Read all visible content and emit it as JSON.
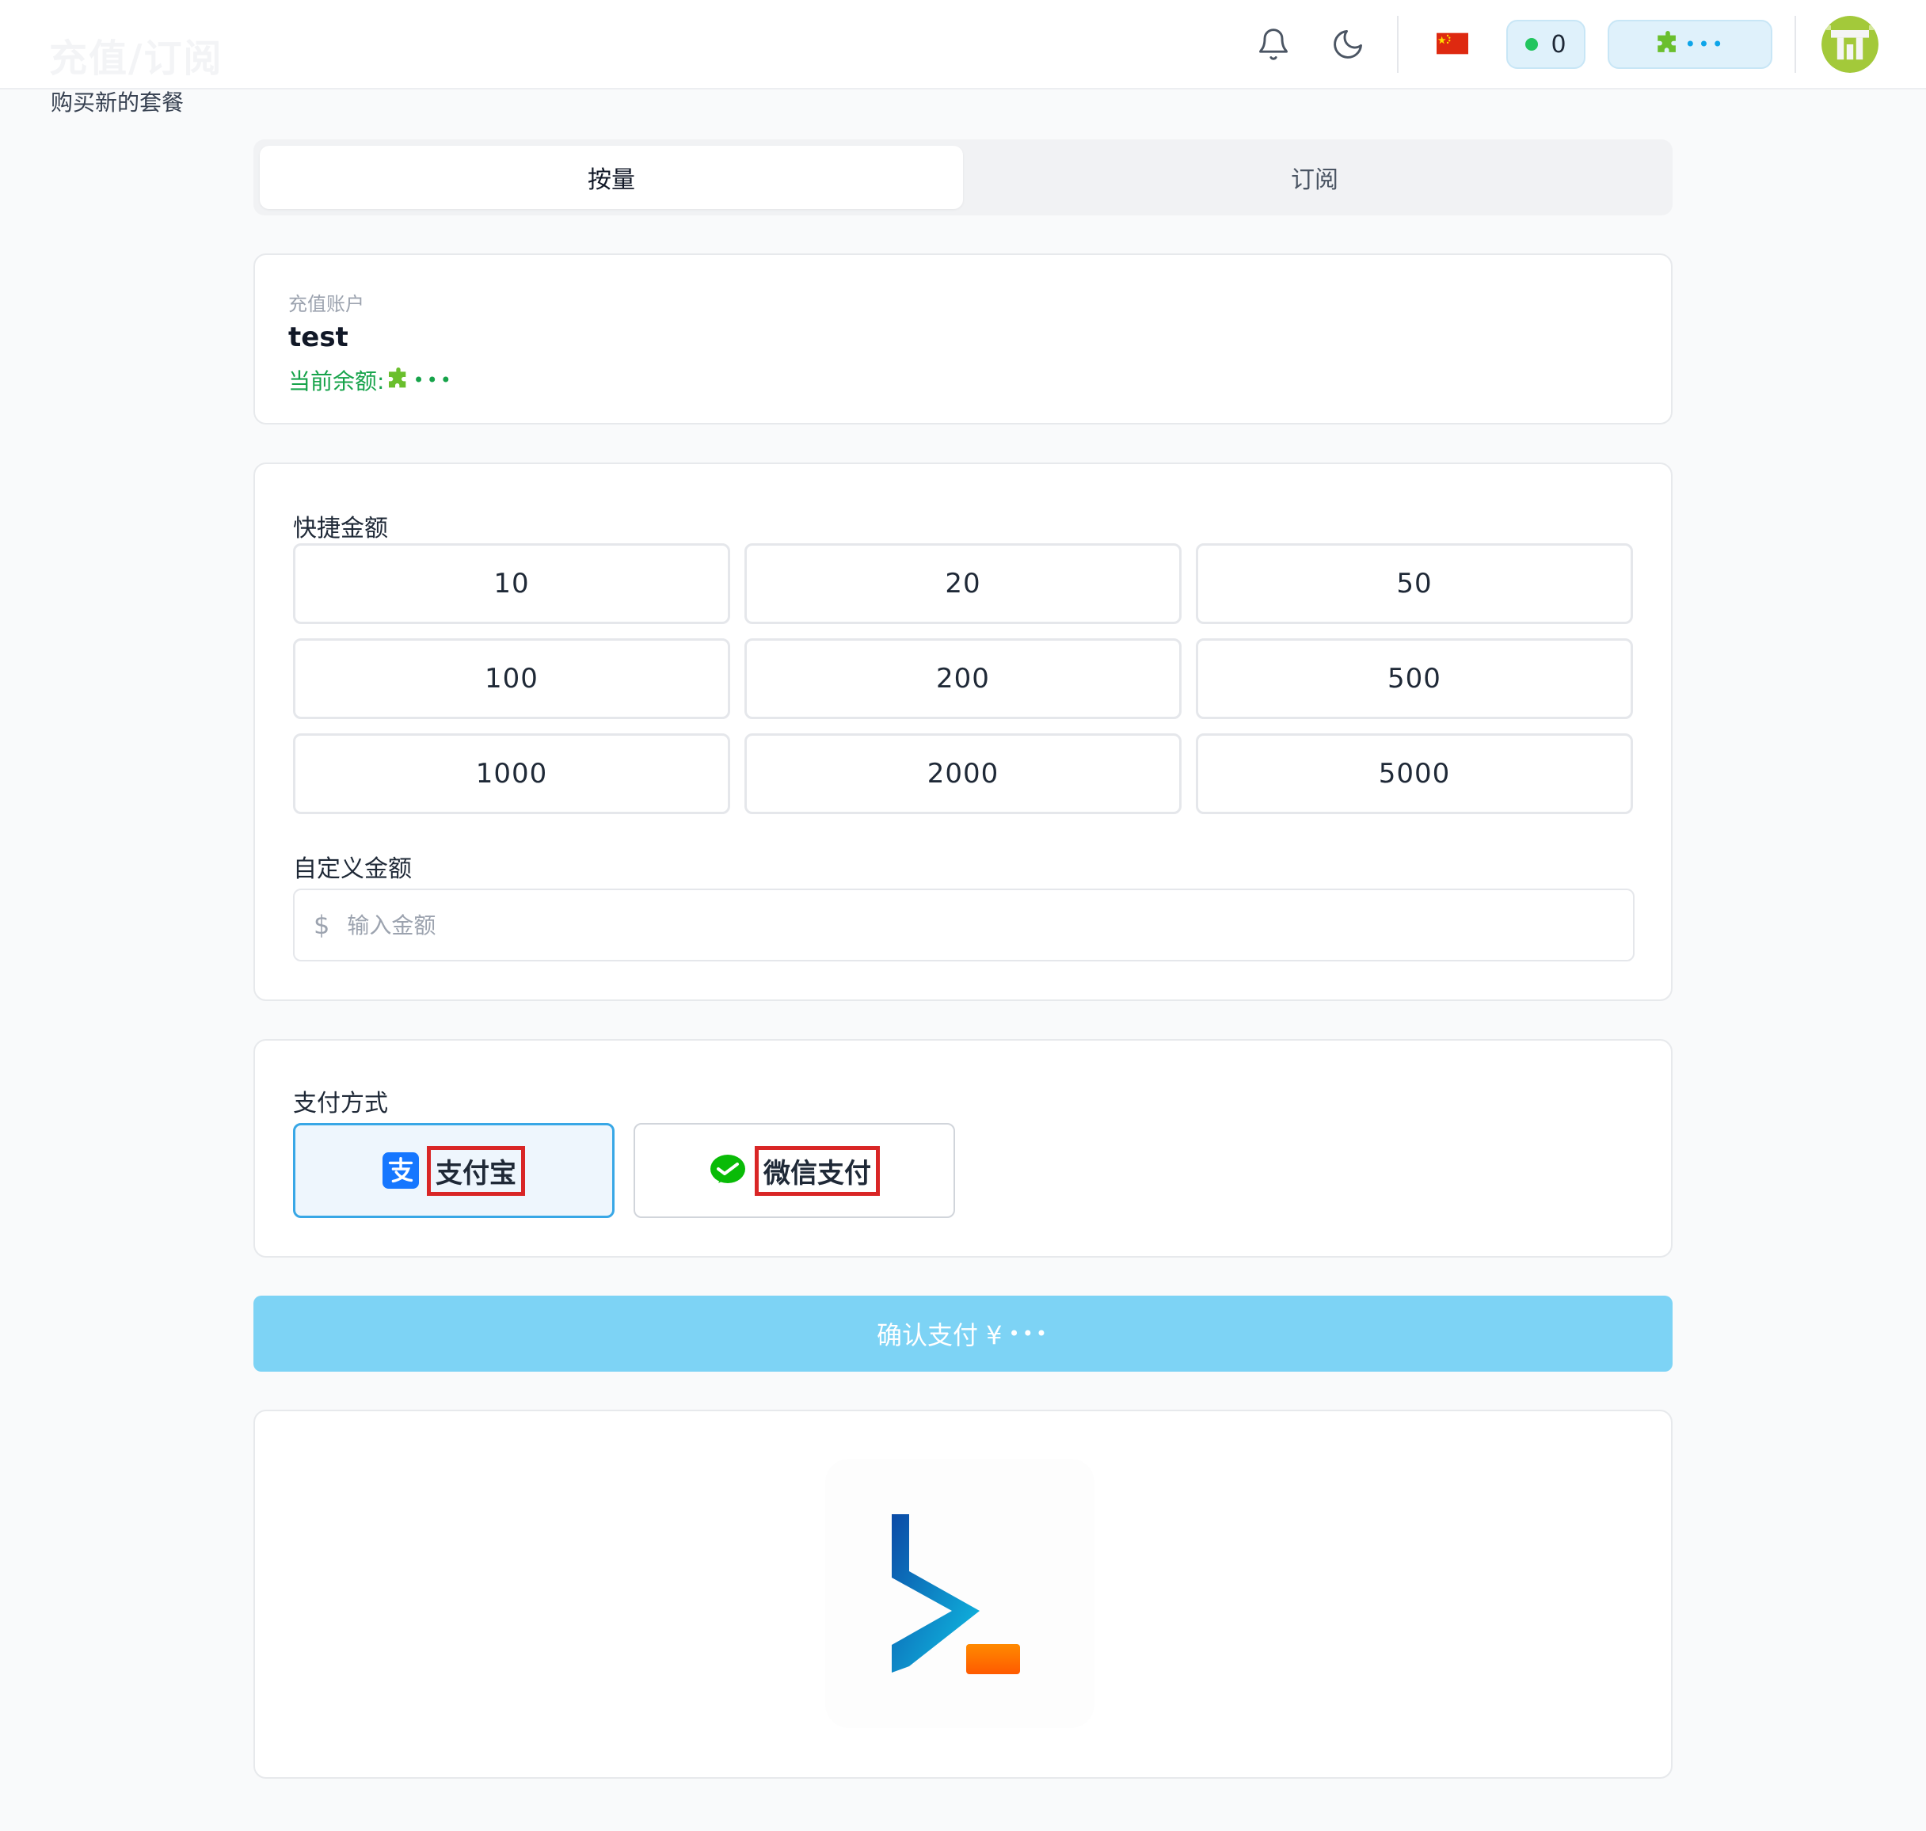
{
  "header": {
    "title": "充值/订阅",
    "subtitle": "购买新的套餐",
    "flag_icon": "china-flag-icon",
    "status_count": "0",
    "balance_mask": "•••",
    "status_color": "#22c55e"
  },
  "tabs": [
    {
      "label": "按量",
      "active": true
    },
    {
      "label": "订阅",
      "active": false
    }
  ],
  "account": {
    "label": "充值账户",
    "name": "test",
    "balance_label": "当前余额:",
    "balance_mask": "•••"
  },
  "amounts": {
    "label": "快捷金额",
    "options": [
      "10",
      "20",
      "50",
      "100",
      "200",
      "500",
      "1000",
      "2000",
      "5000"
    ],
    "custom_label": "自定义金额",
    "currency_symbol": "$",
    "custom_placeholder": "输入金额"
  },
  "payment": {
    "label": "支付方式",
    "methods": [
      {
        "label": "支付宝",
        "icon": "alipay-icon",
        "selected": true
      },
      {
        "label": "微信支付",
        "icon": "wechat-pay-icon",
        "selected": false
      }
    ]
  },
  "confirm": {
    "label": "确认支付 ¥",
    "amount_mask": "•••"
  },
  "colors": {
    "accent": "#38a7e6",
    "confirm_bg": "#7dd3f5",
    "balance_text": "#16a34a",
    "highlight_box": "#d92626"
  }
}
